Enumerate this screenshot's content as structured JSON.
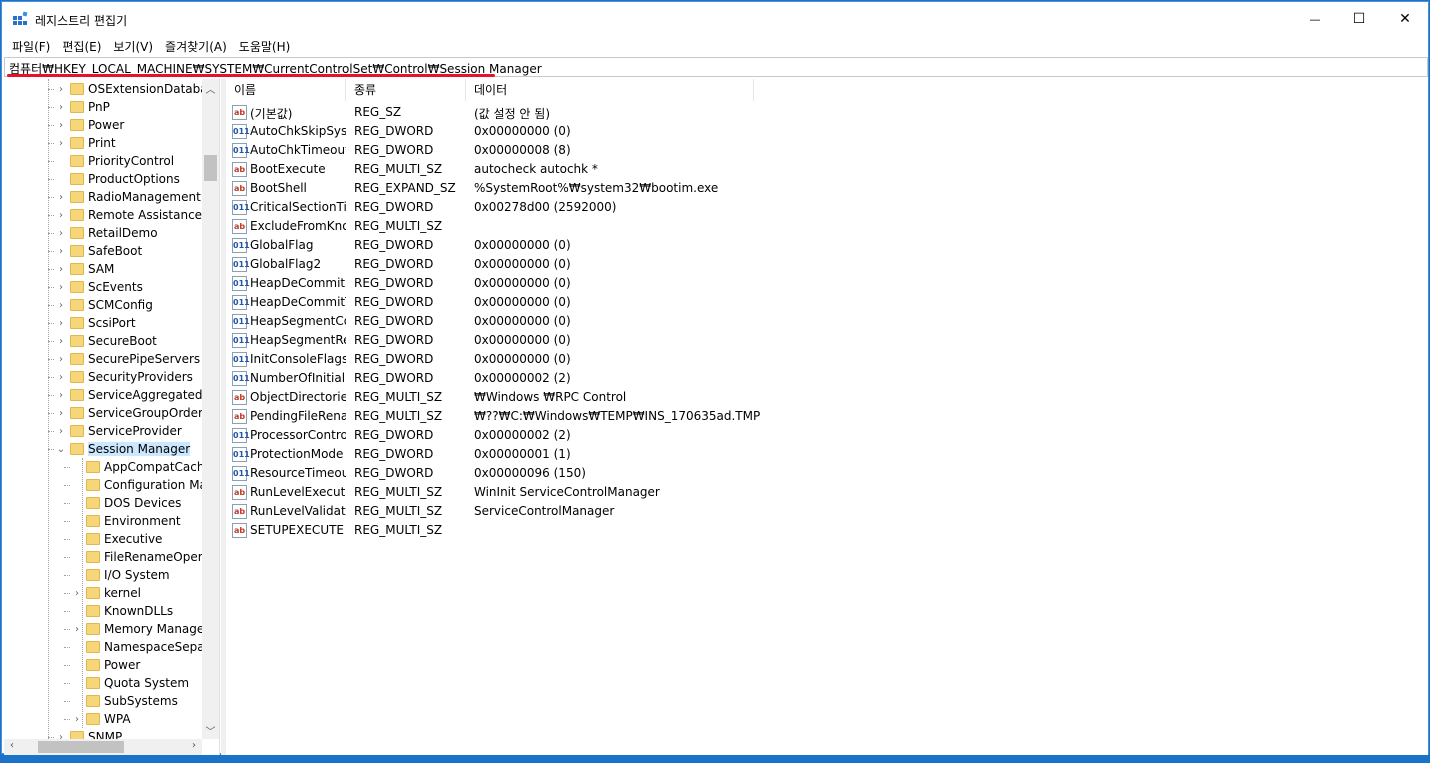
{
  "window": {
    "title": "레지스트리 편집기",
    "minimize": "—",
    "maximize": "☐",
    "close": "✕"
  },
  "menu": [
    "파일(F)",
    "편집(E)",
    "보기(V)",
    "즐겨찾기(A)",
    "도움말(H)"
  ],
  "address": "컴퓨터₩HKEY_LOCAL_MACHINE₩SYSTEM₩CurrentControlSet₩Control₩Session Manager",
  "tree": {
    "items": [
      {
        "label": "OSExtensionDatabase",
        "level": 0,
        "expandable": true
      },
      {
        "label": "PnP",
        "level": 0,
        "expandable": true
      },
      {
        "label": "Power",
        "level": 0,
        "expandable": true
      },
      {
        "label": "Print",
        "level": 0,
        "expandable": true
      },
      {
        "label": "PriorityControl",
        "level": 0,
        "expandable": false
      },
      {
        "label": "ProductOptions",
        "level": 0,
        "expandable": false
      },
      {
        "label": "RadioManagement",
        "level": 0,
        "expandable": true
      },
      {
        "label": "Remote Assistance",
        "level": 0,
        "expandable": true
      },
      {
        "label": "RetailDemo",
        "level": 0,
        "expandable": true
      },
      {
        "label": "SafeBoot",
        "level": 0,
        "expandable": true
      },
      {
        "label": "SAM",
        "level": 0,
        "expandable": true
      },
      {
        "label": "ScEvents",
        "level": 0,
        "expandable": true
      },
      {
        "label": "SCMConfig",
        "level": 0,
        "expandable": true
      },
      {
        "label": "ScsiPort",
        "level": 0,
        "expandable": true
      },
      {
        "label": "SecureBoot",
        "level": 0,
        "expandable": true
      },
      {
        "label": "SecurePipeServers",
        "level": 0,
        "expandable": true
      },
      {
        "label": "SecurityProviders",
        "level": 0,
        "expandable": true
      },
      {
        "label": "ServiceAggregatedEvents",
        "level": 0,
        "expandable": true
      },
      {
        "label": "ServiceGroupOrder",
        "level": 0,
        "expandable": true
      },
      {
        "label": "ServiceProvider",
        "level": 0,
        "expandable": true
      },
      {
        "label": "Session Manager",
        "level": 0,
        "expandable": true,
        "expanded": true,
        "selected": true
      },
      {
        "label": "AppCompatCache",
        "level": 1,
        "expandable": false
      },
      {
        "label": "Configuration Manager",
        "level": 1,
        "expandable": false
      },
      {
        "label": "DOS Devices",
        "level": 1,
        "expandable": false
      },
      {
        "label": "Environment",
        "level": 1,
        "expandable": false
      },
      {
        "label": "Executive",
        "level": 1,
        "expandable": false
      },
      {
        "label": "FileRenameOperations",
        "level": 1,
        "expandable": false
      },
      {
        "label": "I/O System",
        "level": 1,
        "expandable": false
      },
      {
        "label": "kernel",
        "level": 1,
        "expandable": true
      },
      {
        "label": "KnownDLLs",
        "level": 1,
        "expandable": false
      },
      {
        "label": "Memory Management",
        "level": 1,
        "expandable": true
      },
      {
        "label": "NamespaceSeparation",
        "level": 1,
        "expandable": false
      },
      {
        "label": "Power",
        "level": 1,
        "expandable": false
      },
      {
        "label": "Quota System",
        "level": 1,
        "expandable": false
      },
      {
        "label": "SubSystems",
        "level": 1,
        "expandable": false
      },
      {
        "label": "WPA",
        "level": 1,
        "expandable": true
      },
      {
        "label": "SNMP",
        "level": 0,
        "expandable": true
      }
    ]
  },
  "columns": [
    "이름",
    "종류",
    "데이터"
  ],
  "values": [
    {
      "name": "(기본값)",
      "type": "REG_SZ",
      "data": "(값 설정 안 됨)",
      "icon": "ab"
    },
    {
      "name": "AutoChkSkipSystemPartition",
      "type": "REG_DWORD",
      "data": "0x00000000 (0)",
      "icon": "dw"
    },
    {
      "name": "AutoChkTimeout",
      "type": "REG_DWORD",
      "data": "0x00000008 (8)",
      "icon": "dw"
    },
    {
      "name": "BootExecute",
      "type": "REG_MULTI_SZ",
      "data": "autocheck autochk *",
      "icon": "ab"
    },
    {
      "name": "BootShell",
      "type": "REG_EXPAND_SZ",
      "data": "%SystemRoot%₩system32₩bootim.exe",
      "icon": "ab"
    },
    {
      "name": "CriticalSectionTimeout",
      "type": "REG_DWORD",
      "data": "0x00278d00 (2592000)",
      "icon": "dw"
    },
    {
      "name": "ExcludeFromKnownDlls",
      "type": "REG_MULTI_SZ",
      "data": "",
      "icon": "ab"
    },
    {
      "name": "GlobalFlag",
      "type": "REG_DWORD",
      "data": "0x00000000 (0)",
      "icon": "dw"
    },
    {
      "name": "GlobalFlag2",
      "type": "REG_DWORD",
      "data": "0x00000000 (0)",
      "icon": "dw"
    },
    {
      "name": "HeapDeCommitFreeBlockThreshold",
      "type": "REG_DWORD",
      "data": "0x00000000 (0)",
      "icon": "dw"
    },
    {
      "name": "HeapDeCommitTotalFreeThreshold",
      "type": "REG_DWORD",
      "data": "0x00000000 (0)",
      "icon": "dw"
    },
    {
      "name": "HeapSegmentCommit",
      "type": "REG_DWORD",
      "data": "0x00000000 (0)",
      "icon": "dw"
    },
    {
      "name": "HeapSegmentReserve",
      "type": "REG_DWORD",
      "data": "0x00000000 (0)",
      "icon": "dw"
    },
    {
      "name": "InitConsoleFlags",
      "type": "REG_DWORD",
      "data": "0x00000000 (0)",
      "icon": "dw"
    },
    {
      "name": "NumberOfInitialSessions",
      "type": "REG_DWORD",
      "data": "0x00000002 (2)",
      "icon": "dw"
    },
    {
      "name": "ObjectDirectories",
      "type": "REG_MULTI_SZ",
      "data": "₩Windows ₩RPC Control",
      "icon": "ab"
    },
    {
      "name": "PendingFileRenameOperations",
      "type": "REG_MULTI_SZ",
      "data": "₩??₩C:₩Windows₩TEMP₩INS_170635ad.TMP",
      "icon": "ab"
    },
    {
      "name": "ProcessorControl",
      "type": "REG_DWORD",
      "data": "0x00000002 (2)",
      "icon": "dw"
    },
    {
      "name": "ProtectionMode",
      "type": "REG_DWORD",
      "data": "0x00000001 (1)",
      "icon": "dw"
    },
    {
      "name": "ResourceTimeoutCount",
      "type": "REG_DWORD",
      "data": "0x00000096 (150)",
      "icon": "dw"
    },
    {
      "name": "RunLevelExecute",
      "type": "REG_MULTI_SZ",
      "data": "WinInit ServiceControlManager",
      "icon": "ab"
    },
    {
      "name": "RunLevelValidate",
      "type": "REG_MULTI_SZ",
      "data": "ServiceControlManager",
      "icon": "ab"
    },
    {
      "name": "SETUPEXECUTE",
      "type": "REG_MULTI_SZ",
      "data": "",
      "icon": "ab"
    }
  ],
  "icons": {
    "string_value": "ab",
    "dword_value": "011",
    "folder": "folder-icon"
  },
  "colors": {
    "accent_underline": "#e8102a",
    "selection": "#cce8ff",
    "window_border": "#4a90d9"
  }
}
